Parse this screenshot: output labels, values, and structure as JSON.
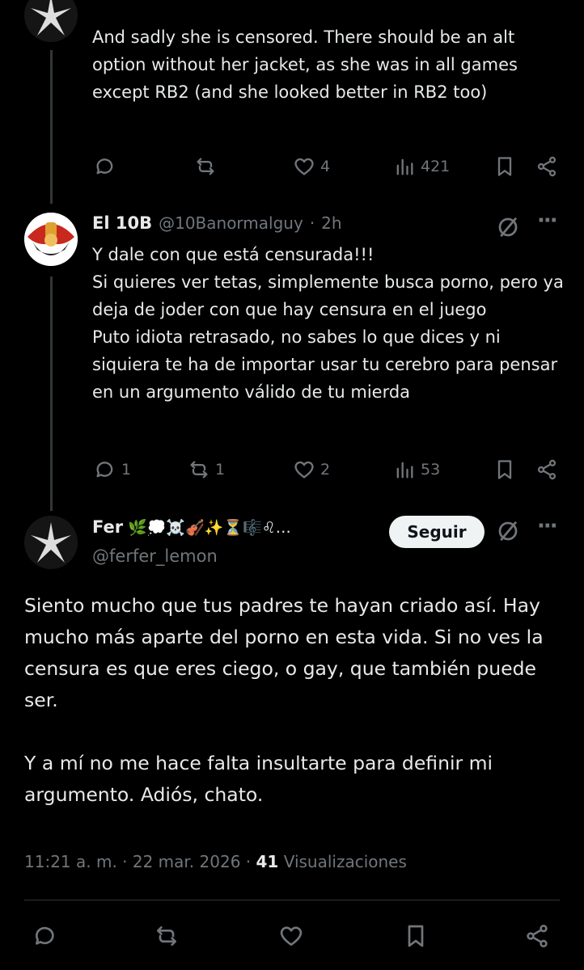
{
  "tweet1": {
    "text": "And sadly she is censored. There should be an alt option without her jacket, as she was in all games except RB2 (and she looked better in RB2 too)",
    "likes": "4",
    "views": "421"
  },
  "tweet2": {
    "name": "El 10B",
    "handle": "@10Banormalguy",
    "time": "2h",
    "text": "Y dale con que está censurada!!!\nSi quieres ver tetas, simplemente busca porno, pero ya deja de joder con que hay censura en el juego\nPuto idiota retrasado, no sabes lo que dices y ni siquiera te ha de importar usar tu cerebro para pensar en un argumento válido de tu mierda",
    "replies": "1",
    "reposts": "1",
    "likes": "2",
    "views": "53"
  },
  "tweet3": {
    "name": "Fer",
    "name_emojis": "🌿💭☠️🎻✨⏳🎼♌…",
    "handle": "@ferfer_lemon",
    "follow_label": "Seguir",
    "text": "Siento mucho que tus padres te hayan criado así. Hay mucho más aparte del porno en esta vida. Si no ves la censura es que eres ciego, o gay, que también puede ser.\n\nY a mí no me hace falta insultarte para definir mi argumento. Adiós, chato.",
    "timestamp": "11:21 a. m. · 22 mar. 2026 · ",
    "view_count": "41",
    "view_label": " Visualizaciones"
  },
  "icons": {
    "reply": "reply-icon",
    "repost": "repost-icon",
    "like": "heart-icon",
    "views": "views-icon",
    "bookmark": "bookmark-icon",
    "share": "share-icon",
    "grok": "grok-icon",
    "more": "more-icon"
  }
}
